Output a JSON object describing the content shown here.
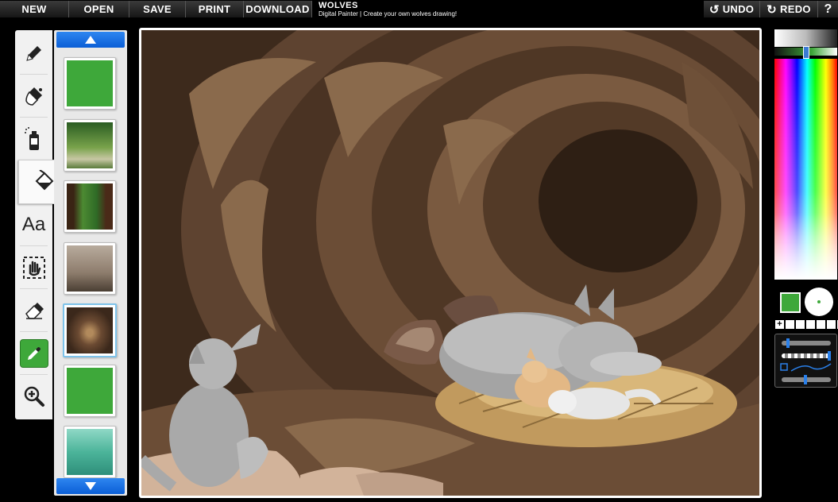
{
  "menu": {
    "new": "NEW",
    "open": "OPEN",
    "save": "SAVE",
    "print": "PRINT",
    "download": "DOWNLOAD",
    "undo": "UNDO",
    "redo": "REDO",
    "help": "?"
  },
  "app": {
    "title": "WOLVES",
    "subtitle": "Digital Painter | Create your own wolves drawing!"
  },
  "tools": [
    {
      "icon": "pencil-icon"
    },
    {
      "icon": "brush-icon"
    },
    {
      "icon": "spray-can-icon"
    },
    {
      "icon": "paint-bucket-icon",
      "active": true
    },
    {
      "icon": "text-icon",
      "label": "Aa"
    },
    {
      "icon": "move-hand-icon"
    },
    {
      "icon": "eraser-icon"
    },
    {
      "icon": "eyedropper-icon"
    },
    {
      "icon": "zoom-in-icon"
    }
  ],
  "backgrounds": [
    {
      "name": "solid-green",
      "selected": false
    },
    {
      "name": "forest-rocks",
      "selected": false
    },
    {
      "name": "forest-path",
      "selected": false
    },
    {
      "name": "bare-trees",
      "selected": false
    },
    {
      "name": "wolf-cave",
      "selected": true
    },
    {
      "name": "solid-green-2",
      "selected": false
    },
    {
      "name": "teal-landscape",
      "selected": false
    }
  ],
  "colors": {
    "current": "#3ea83a",
    "cave_dark": "#3d2a1c",
    "cave_mid": "#5e4330",
    "cave_light": "#8a6a4c",
    "accent_blue": "#1a6fe0"
  },
  "palette_add": "+"
}
